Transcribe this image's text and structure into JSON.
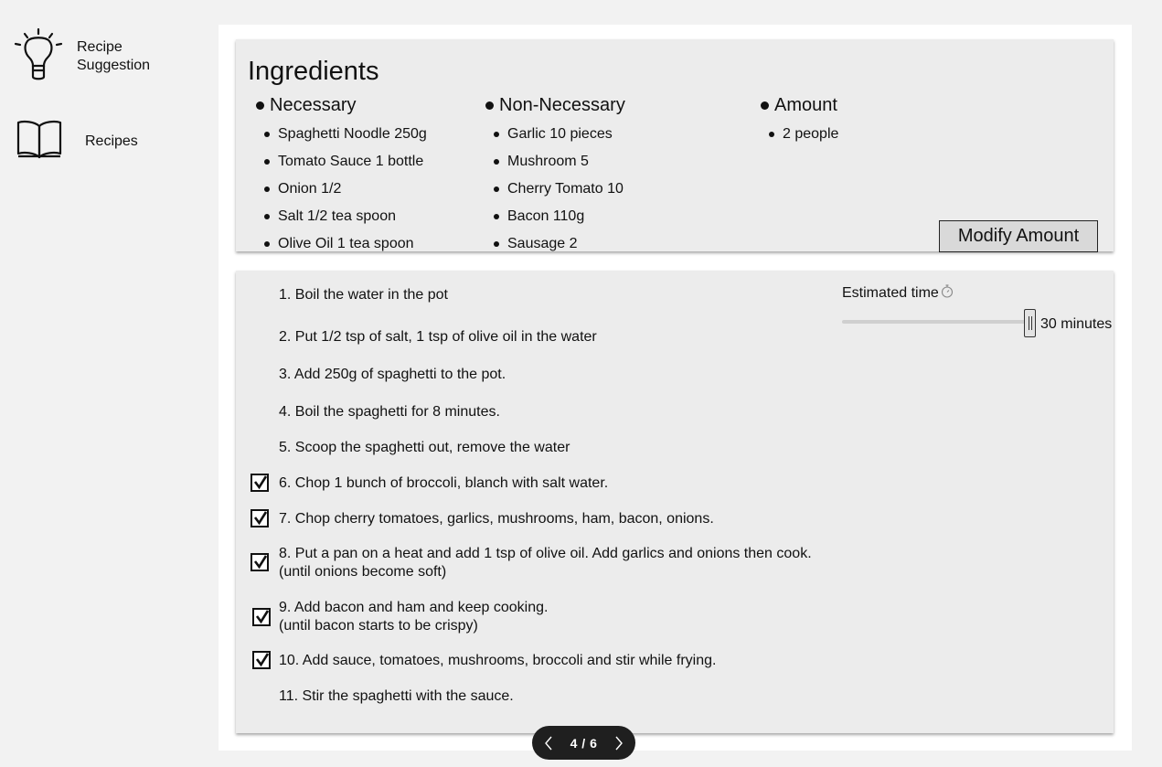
{
  "sidebar": {
    "items": [
      {
        "label": "Recipe Suggestion",
        "icon": "lightbulb-icon"
      },
      {
        "label": "Recipes",
        "icon": "book-icon"
      }
    ]
  },
  "ingredients": {
    "title": "Ingredients",
    "necessary": {
      "heading": "Necessary",
      "items": [
        "Spaghetti Noodle 250g",
        "Tomato Sauce 1 bottle",
        "Onion 1/2",
        "Salt 1/2 tea spoon",
        "Olive Oil 1 tea spoon"
      ]
    },
    "non_necessary": {
      "heading": "Non-Necessary",
      "items": [
        "Garlic 10 pieces",
        "Mushroom 5",
        "Cherry Tomato 10",
        "Bacon 110g",
        "Sausage 2"
      ]
    },
    "amount": {
      "heading": "Amount",
      "items": [
        "2 people"
      ]
    },
    "modify_label": "Modify Amount"
  },
  "estimate": {
    "label": "Estimated time",
    "icon": "stopwatch-icon",
    "value": "30 minutes",
    "slider_fraction": 1.0
  },
  "steps": [
    {
      "text": "1. Boil the water in the pot",
      "checked": false
    },
    {
      "text": "2. Put 1/2 tsp of salt, 1 tsp of olive oil in the water",
      "checked": false
    },
    {
      "text": "3. Add 250g of spaghetti to the pot.",
      "checked": false
    },
    {
      "text": "4. Boil the spaghetti for 8 minutes.",
      "checked": false
    },
    {
      "text": "5. Scoop the spaghetti out, remove the water",
      "checked": false
    },
    {
      "text": "6. Chop 1 bunch of broccoli, blanch with salt water.",
      "checked": true
    },
    {
      "text": "7. Chop cherry tomatoes, garlics, mushrooms, ham, bacon, onions.",
      "checked": true
    },
    {
      "text": "8. Put a pan on a heat and add 1 tsp of olive oil. Add garlics and onions then cook.",
      "note": "(until onions become soft)",
      "checked": true
    },
    {
      "text": "9. Add bacon and ham and keep cooking.",
      "note": "(until bacon starts to be crispy)",
      "checked": true
    },
    {
      "text": "10. Add sauce, tomatoes, mushrooms, broccoli and stir while frying.",
      "checked": true
    },
    {
      "text": "11. Stir the spaghetti with the sauce.",
      "checked": false
    }
  ],
  "pager": {
    "label": "4 / 6",
    "current": 4,
    "total": 6
  }
}
